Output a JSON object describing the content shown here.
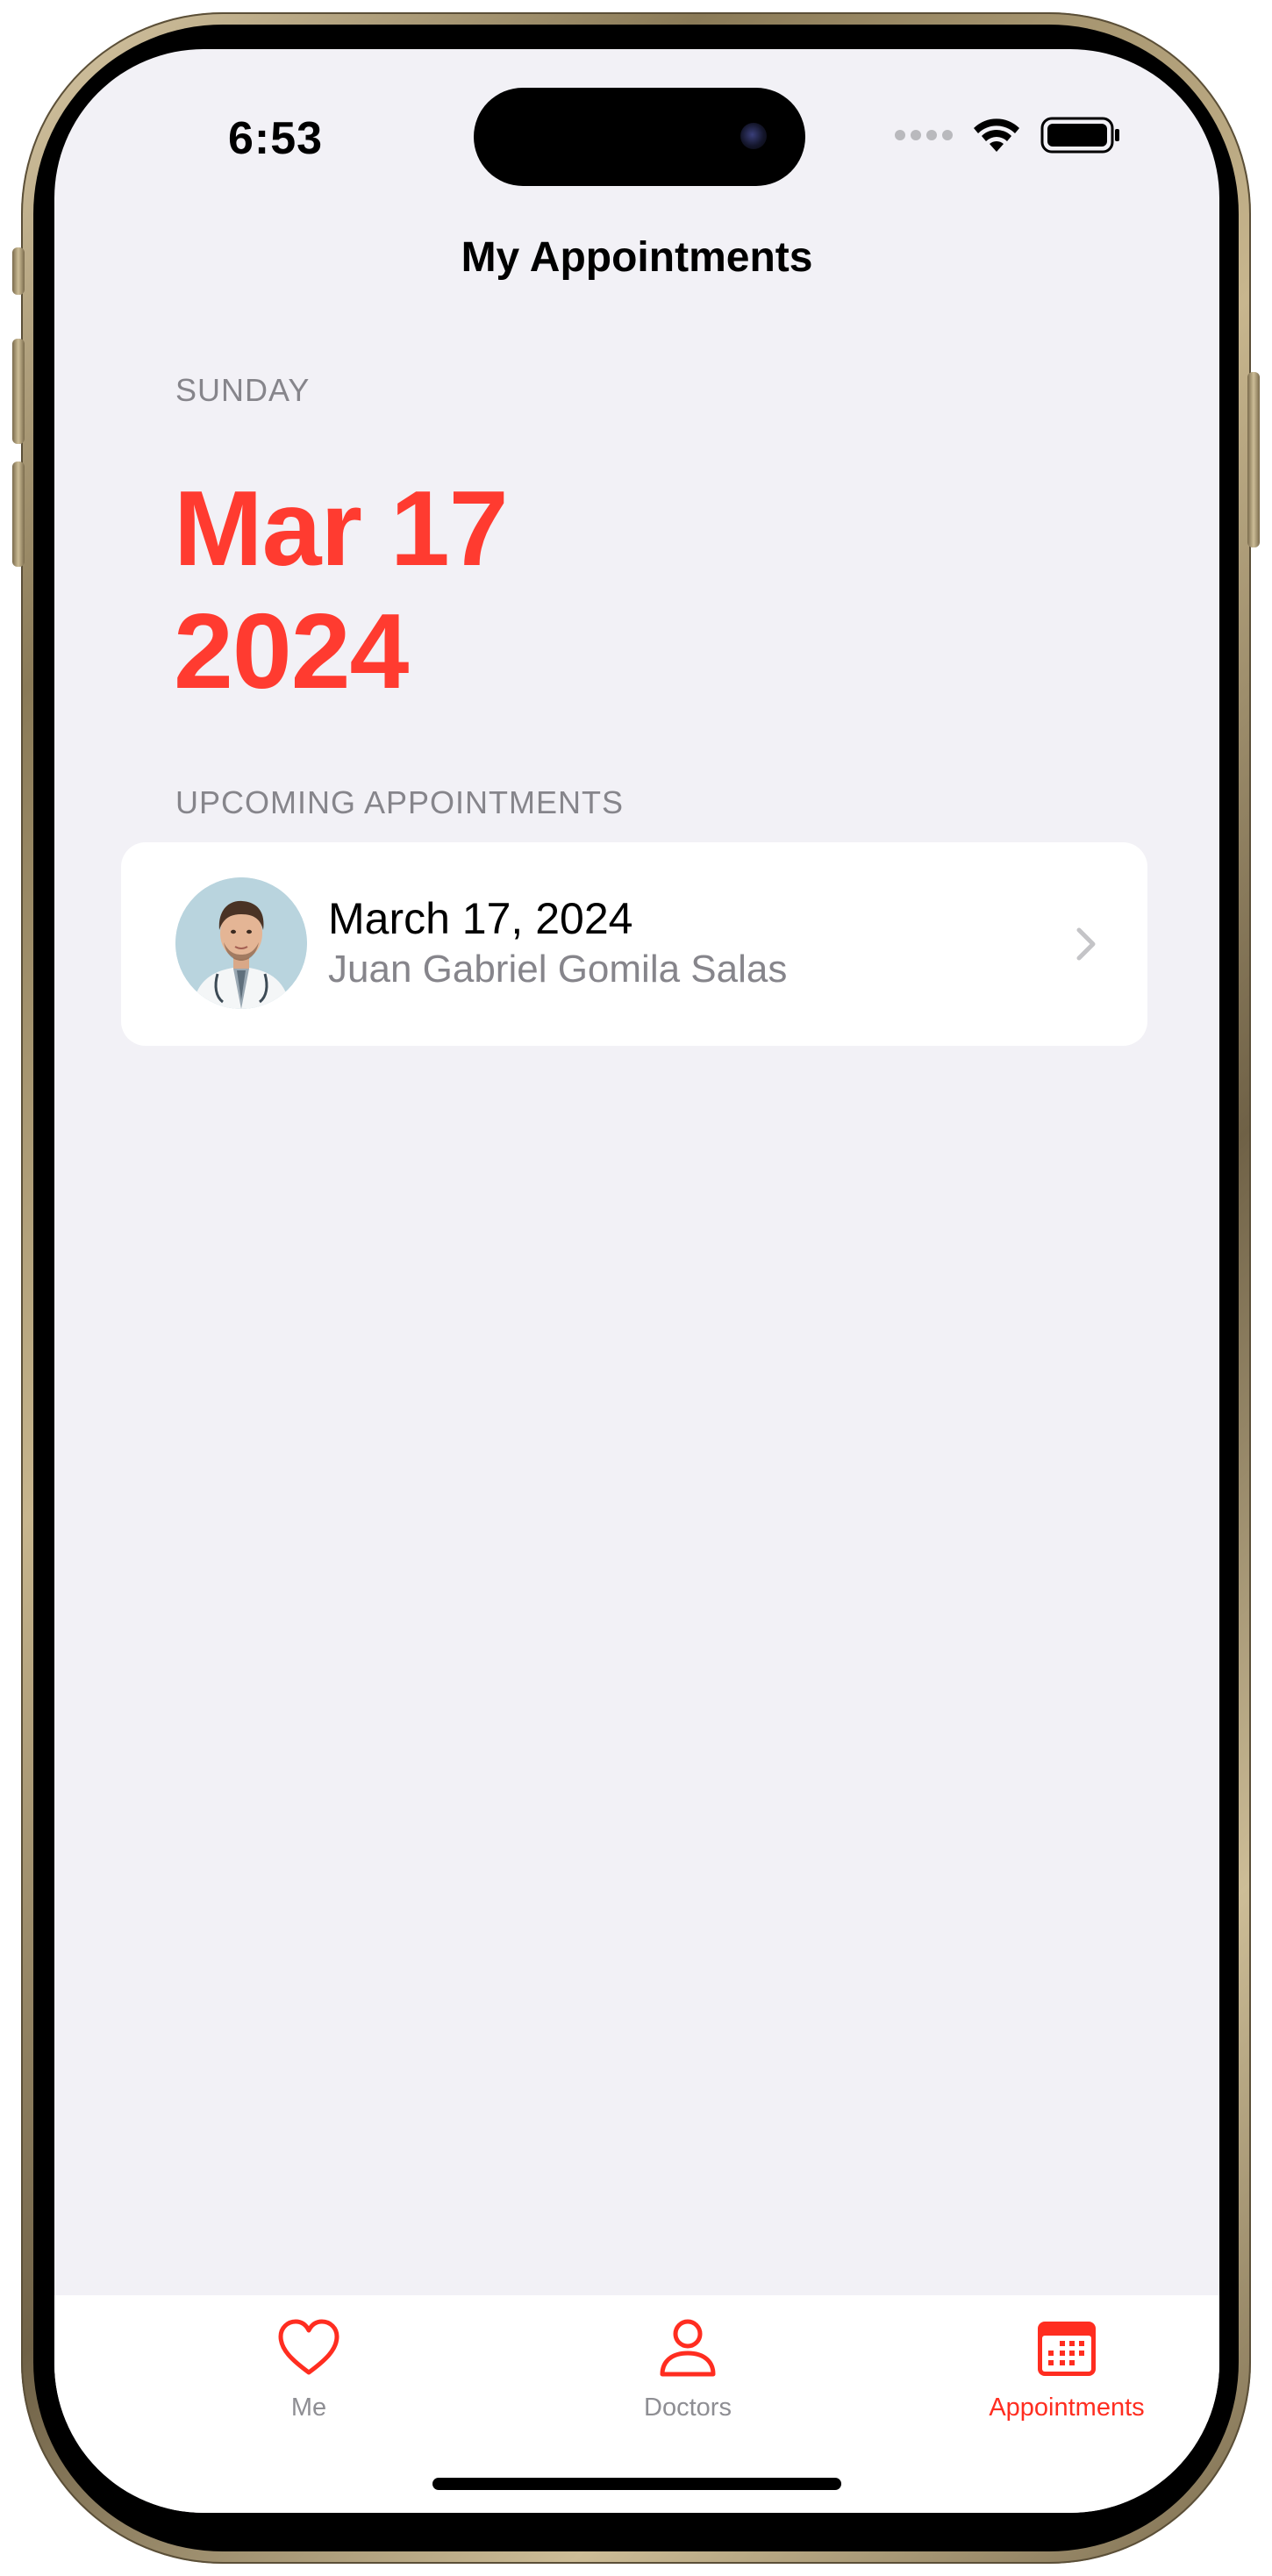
{
  "status_bar": {
    "time": "6:53"
  },
  "nav": {
    "title": "My Appointments"
  },
  "today": {
    "weekday": "SUNDAY",
    "month_day": "Mar 17",
    "year": "2024"
  },
  "upcoming": {
    "header": "UPCOMING APPOINTMENTS",
    "items": [
      {
        "date": "March 17, 2024",
        "doctor": "Juan Gabriel Gomila Salas",
        "avatar_icon": "doctor-avatar"
      }
    ]
  },
  "tabbar": {
    "tabs": [
      {
        "label": "Me",
        "icon": "heart-icon",
        "selected": false
      },
      {
        "label": "Doctors",
        "icon": "person-icon",
        "selected": false
      },
      {
        "label": "Appointments",
        "icon": "calendar-icon",
        "selected": true
      }
    ]
  },
  "colors": {
    "accent": "#ff3b30",
    "secondary_text": "#86858b",
    "background": "#f2f1f6",
    "tab_inactive": "#8e8e93"
  }
}
